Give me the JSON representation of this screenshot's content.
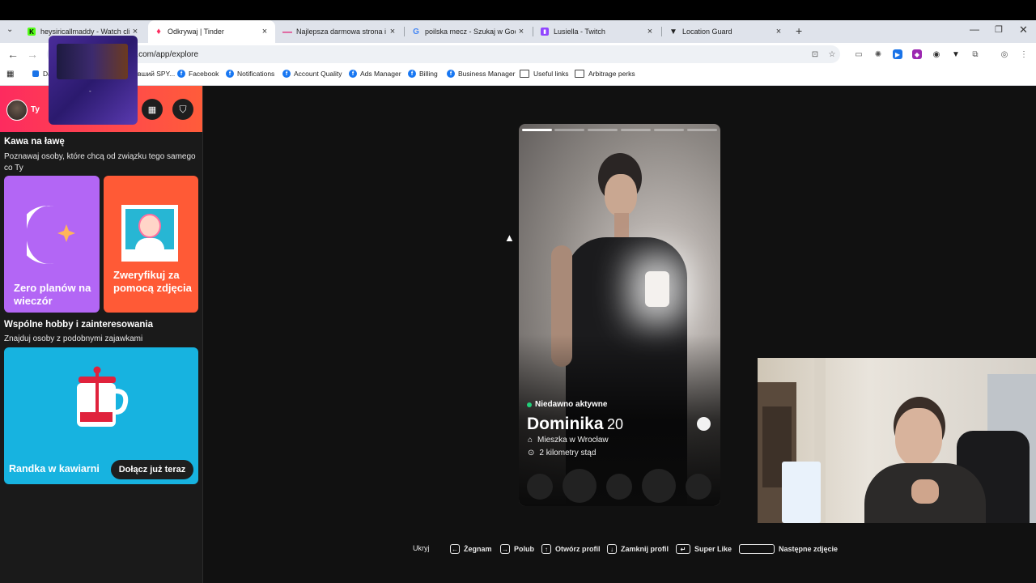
{
  "tabs": [
    {
      "title": "heysiricallmaddy - Watch clips...",
      "icon": "kick-icon",
      "active": false
    },
    {
      "title": "Odkrywaj | Tinder",
      "icon": "tinder-icon",
      "active": true
    },
    {
      "title": "Najlepsza darmowa strona i ap...",
      "icon": "dash-icon",
      "active": false
    },
    {
      "title": "poilska mecz - Szukaj w Google",
      "icon": "google-icon",
      "active": false
    },
    {
      "title": "Lusiella - Twitch",
      "icon": "twitch-icon",
      "active": false
    },
    {
      "title": "Location Guard",
      "icon": "location-icon",
      "active": false
    }
  ],
  "address": {
    "url": "tinder.com/app/explore",
    "url_visible": "er.com/app/explore"
  },
  "bookmarks": [
    {
      "label": "Da...",
      "type": "site"
    },
    {
      "label": "вший SPY...",
      "type": "site"
    },
    {
      "label": "Facebook",
      "type": "facebook"
    },
    {
      "label": "Notifications",
      "type": "facebook"
    },
    {
      "label": "Account Quality",
      "type": "facebook"
    },
    {
      "label": "Ads Manager",
      "type": "facebook"
    },
    {
      "label": "Billing",
      "type": "facebook"
    },
    {
      "label": "Business Manager",
      "type": "facebook"
    },
    {
      "label": "Useful links",
      "type": "folder"
    },
    {
      "label": "Arbitrage perks",
      "type": "folder"
    }
  ],
  "sidebar": {
    "user_label": "Ty",
    "section1": {
      "title": "Kawa na ławę",
      "subtitle": "Poznawaj osoby, które chcą od związku tego samego co Ty"
    },
    "card_zero": {
      "title": "Zero planów na wieczór",
      "color": "#b366f5"
    },
    "card_verify": {
      "title": "Zweryfikuj za pomocą zdjęcia",
      "color": "#ff5a36"
    },
    "section2": {
      "title": "Wspólne hobby i zainteresowania",
      "subtitle": "Znajduj osoby z podobnymi zajawkami"
    },
    "card_coffee": {
      "title": "Randka w kawiarni",
      "button": "Dołącz już teraz",
      "color": "#17b3e0"
    }
  },
  "profile": {
    "status": "Niedawno aktywne",
    "name": "Dominika",
    "age": "20",
    "city": "Mieszka w Wrocław",
    "distance": "2 kilometry stąd",
    "photo_count": 6,
    "current_photo": 1
  },
  "shortcuts": {
    "hide": "Ukryj",
    "nope": "Żegnam",
    "like": "Polub",
    "open": "Otwórz profil",
    "close": "Zamknij profil",
    "super": "Super Like",
    "next": "Następne zdjęcie"
  },
  "colors": {
    "tinder_gradient_start": "#fd2b5f",
    "tinder_gradient_end": "#ff5c3a",
    "active_green": "#21d07a"
  }
}
